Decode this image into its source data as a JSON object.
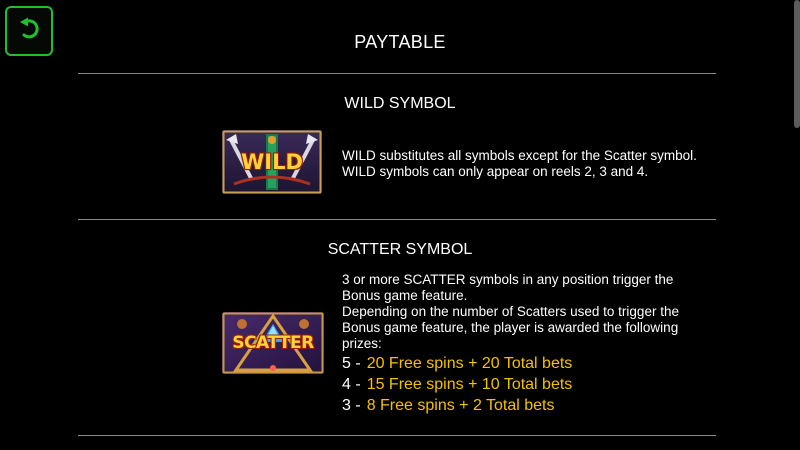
{
  "header": {
    "title": "PAYTABLE",
    "back_icon": "undo-arrow-icon",
    "accent_color": "#1fbf2d"
  },
  "wild": {
    "title": "WILD SYMBOL",
    "image_label": "WILD",
    "lines": [
      "WILD substitutes all symbols except for the Scatter symbol.",
      "WILD symbols can only appear on reels 2, 3 and 4."
    ]
  },
  "scatter": {
    "title": "SCATTER SYMBOL",
    "image_label": "SCATTER",
    "lines": [
      "3 or more SCATTER symbols in any position trigger the",
      "Bonus game feature.",
      "Depending on the number of Scatters used to trigger the",
      "Bonus game feature, the player is awarded the following",
      "prizes:"
    ],
    "prizes": [
      {
        "count": "5",
        "text": "20 Free spins + 20 Total bets"
      },
      {
        "count": "4",
        "text": "15 Free spins + 10 Total bets"
      },
      {
        "count": "3",
        "text": "8 Free spins + 2 Total bets"
      }
    ],
    "prize_color": "#f2c200"
  }
}
